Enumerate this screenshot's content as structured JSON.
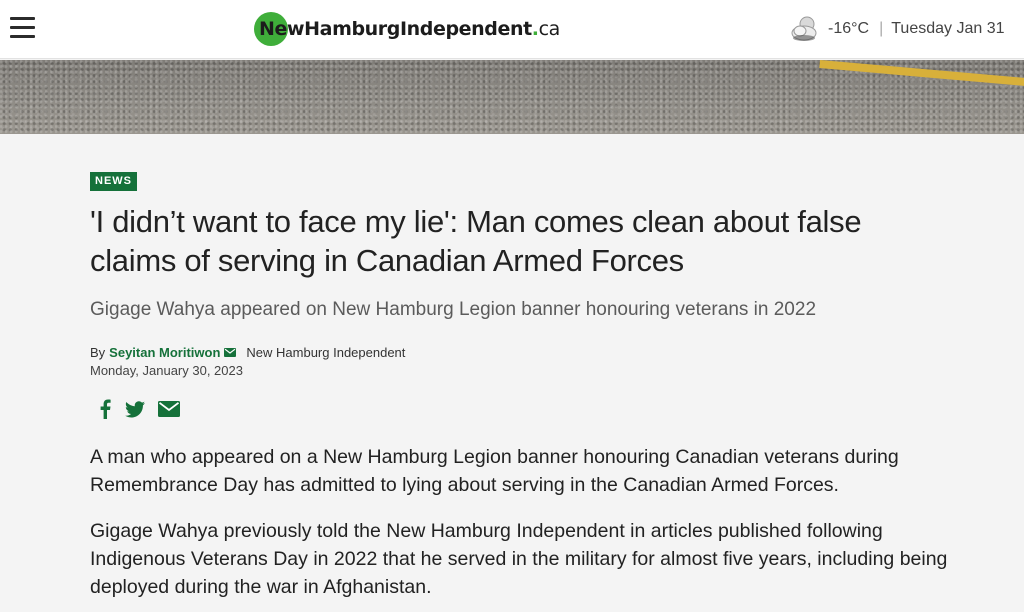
{
  "header": {
    "logo": {
      "part1": "NewHamburgIndependent",
      "dot": ".",
      "tld": "ca"
    },
    "weather": {
      "icon": "partly-cloudy-icon",
      "temperature": "-16°C",
      "date": "Tuesday Jan 31"
    },
    "menu_icon": "hamburger-menu-icon"
  },
  "article": {
    "category": "NEWS",
    "headline": "'I didn’t want to face my lie': Man comes clean about false claims of serving in Canadian Armed Forces",
    "subhead": "Gigage Wahya appeared on New Hamburg Legion banner honouring veterans in 2022",
    "byline": {
      "by": "By",
      "author": "Seyitan Moritiwon",
      "publication": "New Hamburg Independent"
    },
    "date": "Monday, January 30, 2023",
    "share": [
      "facebook-icon",
      "twitter-icon",
      "email-icon"
    ],
    "paragraphs": [
      "A man who appeared on a New Hamburg Legion banner honouring Canadian veterans during Remembrance Day has admitted to lying about serving in the Canadian Armed Forces.",
      "Gigage Wahya previously told the New Hamburg Independent in articles published following Indigenous Veterans Day in 2022 that he served in the military for almost five years, including being deployed during the war in Afghanistan."
    ]
  },
  "colors": {
    "brand_green": "#3fae3a",
    "accent_green": "#15713a",
    "background": "#f4f4f4"
  }
}
